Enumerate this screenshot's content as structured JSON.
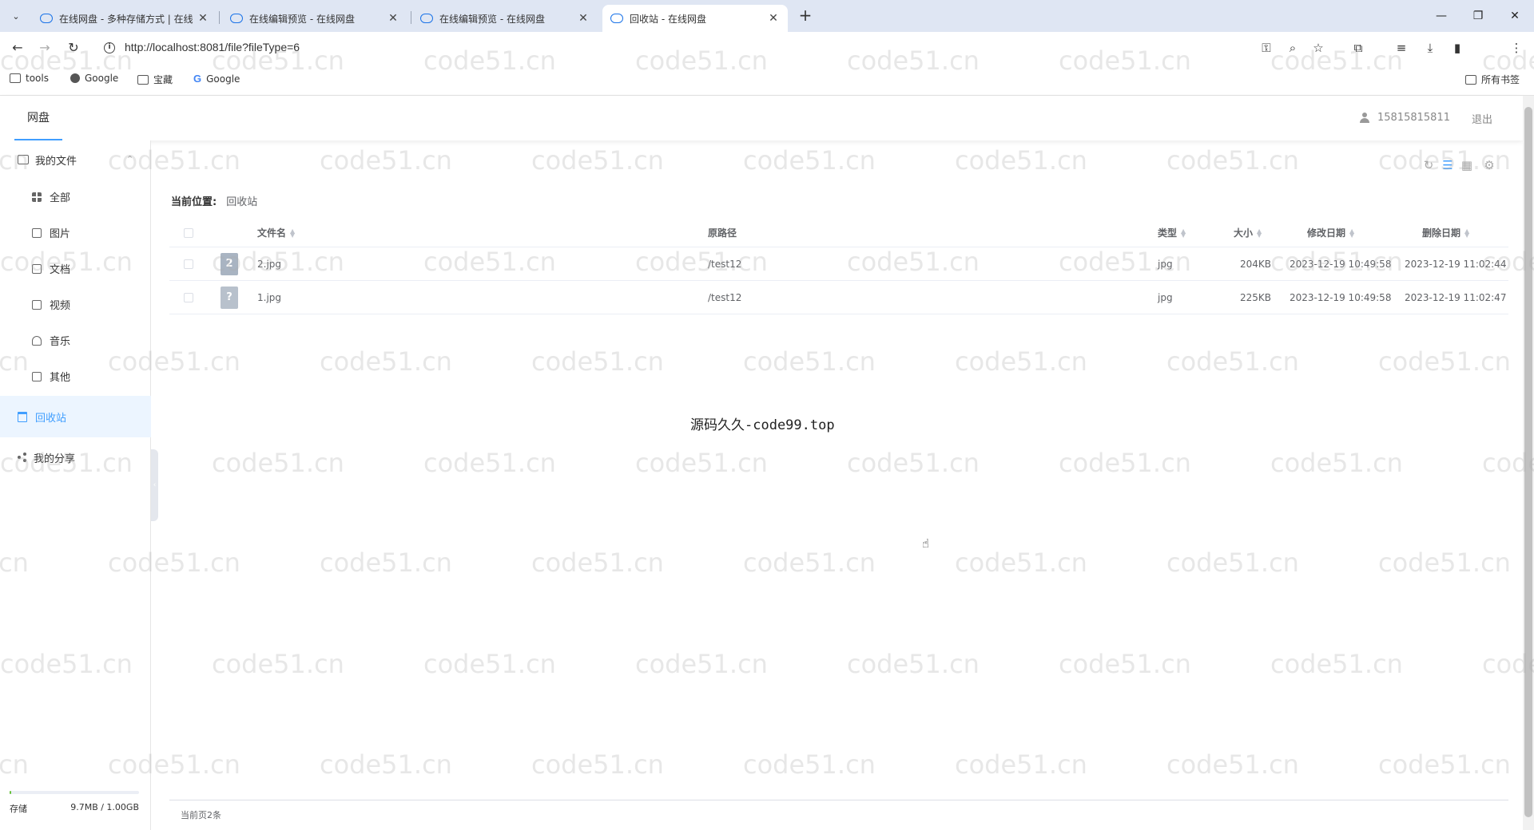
{
  "browser": {
    "tabs": [
      {
        "title": "在线网盘 - 多种存储方式 | 在线",
        "active": false
      },
      {
        "title": "在线编辑预览 - 在线网盘",
        "active": false
      },
      {
        "title": "在线编辑预览 - 在线网盘",
        "active": false
      },
      {
        "title": "回收站 - 在线网盘",
        "active": true
      }
    ],
    "new_tab": "+",
    "url": "http://localhost:8081/file?fileType=6",
    "bookmarks": [
      {
        "label": "tools",
        "icon": "folder-icon"
      },
      {
        "label": "Google",
        "icon": "globe-icon"
      },
      {
        "label": "宝藏",
        "icon": "folder-icon"
      },
      {
        "label": "Google",
        "icon": "google-icon"
      }
    ],
    "all_bookmarks": "所有书签"
  },
  "header": {
    "nav_label": "网盘",
    "user_phone": "15815815811",
    "logout": "退出"
  },
  "sidebar": {
    "my_files": "我的文件",
    "items": [
      {
        "label": "全部",
        "icon": "grid-icon"
      },
      {
        "label": "图片",
        "icon": "image-icon"
      },
      {
        "label": "文档",
        "icon": "document-icon"
      },
      {
        "label": "视频",
        "icon": "video-icon"
      },
      {
        "label": "音乐",
        "icon": "headphones-icon"
      },
      {
        "label": "其他",
        "icon": "box-icon"
      }
    ],
    "recycle": "回收站",
    "my_share": "我的分享",
    "storage_label": "存储",
    "storage_value": "9.7MB / 1.00GB",
    "storage_fraction": 0.0095
  },
  "main": {
    "breadcrumb_label": "当前位置:",
    "breadcrumb_item": "回收站",
    "columns": {
      "name": "文件名",
      "path": "原路径",
      "type": "类型",
      "size": "大小",
      "modified": "修改日期",
      "deleted": "删除日期"
    },
    "rows": [
      {
        "icon": "2",
        "name": "2.jpg",
        "path": "/test12",
        "type": "jpg",
        "size": "204KB",
        "modified": "2023-12-19 10:49:58",
        "deleted": "2023-12-19 11:02:44"
      },
      {
        "icon": "?",
        "name": "1.jpg",
        "path": "/test12",
        "type": "jpg",
        "size": "225KB",
        "modified": "2023-12-19 10:49:58",
        "deleted": "2023-12-19 11:02:47"
      }
    ],
    "center_text": "源码久久-code99.top",
    "pager_text": "当前页2条"
  },
  "watermark": "code51.cn",
  "colors": {
    "accent": "#409eff",
    "recycle_bg": "#ecf5ff",
    "storage": "#67c23a"
  }
}
